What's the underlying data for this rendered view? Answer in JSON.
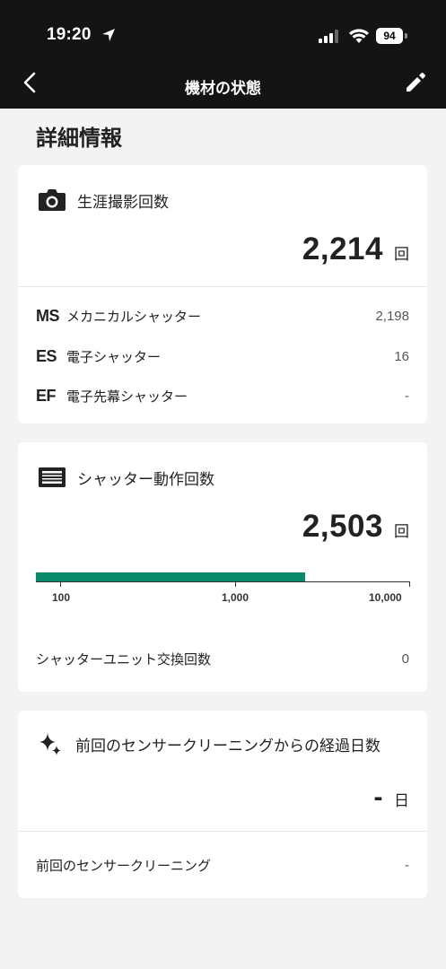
{
  "status_bar": {
    "time": "19:20",
    "battery": "94"
  },
  "nav": {
    "title": "機材の状態"
  },
  "section_title": "詳細情報",
  "total_shots": {
    "label": "生涯撮影回数",
    "count": "2,214",
    "unit": "回",
    "breakdown": [
      {
        "code": "MS",
        "label": "メカニカルシャッター",
        "value": "2,198"
      },
      {
        "code": "ES",
        "label": "電子シャッター",
        "value": "16"
      },
      {
        "code": "EF",
        "label": "電子先幕シャッター",
        "value": "-"
      }
    ]
  },
  "shutter_actuations": {
    "label": "シャッター動作回数",
    "count": "2,503",
    "unit": "回",
    "scale_ticks": [
      "100",
      "1,000",
      "10,000"
    ],
    "progress_value": 2503,
    "bar_color": "#0a8a6a",
    "unit_replacement_label": "シャッターユニット交換回数",
    "unit_replacement_value": "0"
  },
  "sensor_cleaning": {
    "label": "前回のセンサークリーニングからの経過日数",
    "days": "-",
    "unit": "日",
    "last_cleaning_label": "前回のセンサークリーニング",
    "last_cleaning_value": "-"
  },
  "icons": {
    "back": "chevron-left-icon",
    "edit": "pencil-icon",
    "camera": "camera-icon",
    "shutter": "shutter-icon",
    "sparkle": "sparkle-icon"
  }
}
